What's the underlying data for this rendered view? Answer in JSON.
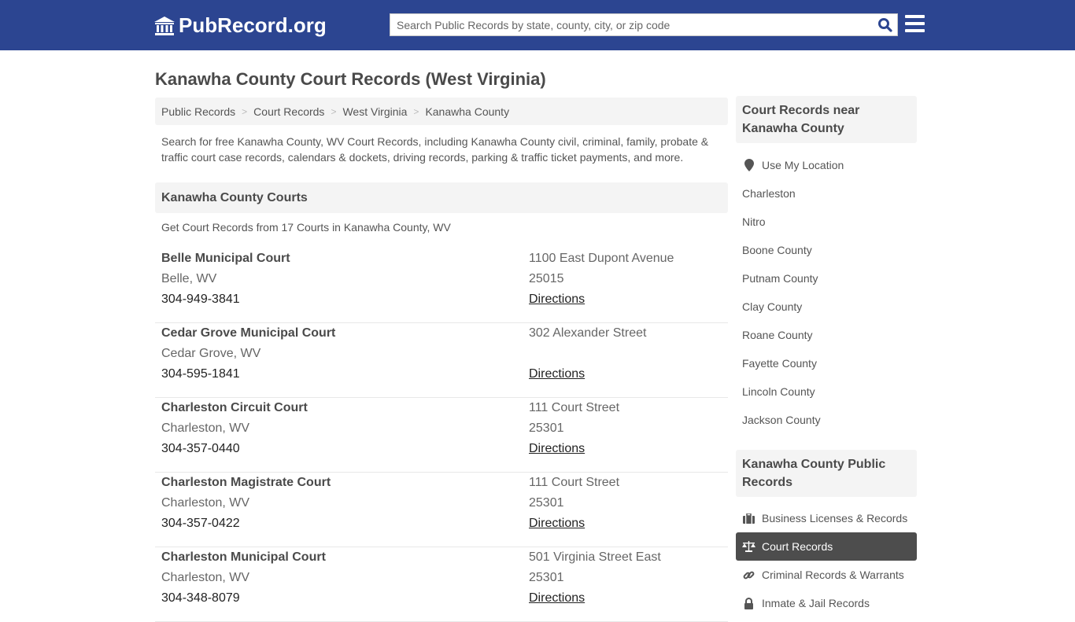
{
  "header": {
    "logo_text": "PubRecord.org",
    "search_placeholder": "Search Public Records by state, county, city, or zip code",
    "brand_color": "#2c4591"
  },
  "page_title": "Kanawha County Court Records (West Virginia)",
  "breadcrumb": [
    {
      "label": "Public Records"
    },
    {
      "label": "Court Records"
    },
    {
      "label": "West Virginia"
    },
    {
      "label": "Kanawha County"
    }
  ],
  "intro": "Search for free Kanawha County, WV Court Records, including Kanawha County civil, criminal, family, probate & traffic court case records, calendars & dockets, driving records, parking & traffic ticket payments, and more.",
  "courts_section": {
    "title": "Kanawha County Courts",
    "subtitle": "Get Court Records from 17 Courts in Kanawha County, WV",
    "directions_label": "Directions",
    "courts": [
      {
        "name": "Belle Municipal Court",
        "city": "Belle, WV",
        "phone": "304-949-3841",
        "address": "1100 East Dupont Avenue",
        "zip": "25015",
        "directions": "Directions"
      },
      {
        "name": "Cedar Grove Municipal Court",
        "city": "Cedar Grove, WV",
        "phone": "304-595-1841",
        "address": "302 Alexander Street",
        "zip": "",
        "directions": "Directions"
      },
      {
        "name": "Charleston Circuit Court",
        "city": "Charleston, WV",
        "phone": "304-357-0440",
        "address": "111 Court Street",
        "zip": "25301",
        "directions": "Directions"
      },
      {
        "name": "Charleston Magistrate Court",
        "city": "Charleston, WV",
        "phone": "304-357-0422",
        "address": "111 Court Street",
        "zip": "25301",
        "directions": "Directions"
      },
      {
        "name": "Charleston Municipal Court",
        "city": "Charleston, WV",
        "phone": "304-348-8079",
        "address": "501 Virginia Street East",
        "zip": "25301",
        "directions": "Directions"
      }
    ]
  },
  "sidebar": {
    "nearby": {
      "title": "Court Records near Kanawha County",
      "use_location": "Use My Location",
      "items": [
        "Charleston",
        "Nitro",
        "Boone County",
        "Putnam County",
        "Clay County",
        "Roane County",
        "Fayette County",
        "Lincoln County",
        "Jackson County"
      ]
    },
    "public_records": {
      "title": "Kanawha County Public Records",
      "items": [
        {
          "label": "Business Licenses & Records",
          "icon": "briefcase-icon",
          "active": false
        },
        {
          "label": "Court Records",
          "icon": "scale-icon",
          "active": true
        },
        {
          "label": "Criminal Records & Warrants",
          "icon": "link-icon",
          "active": false
        },
        {
          "label": "Inmate & Jail Records",
          "icon": "lock-icon",
          "active": false
        }
      ]
    }
  }
}
